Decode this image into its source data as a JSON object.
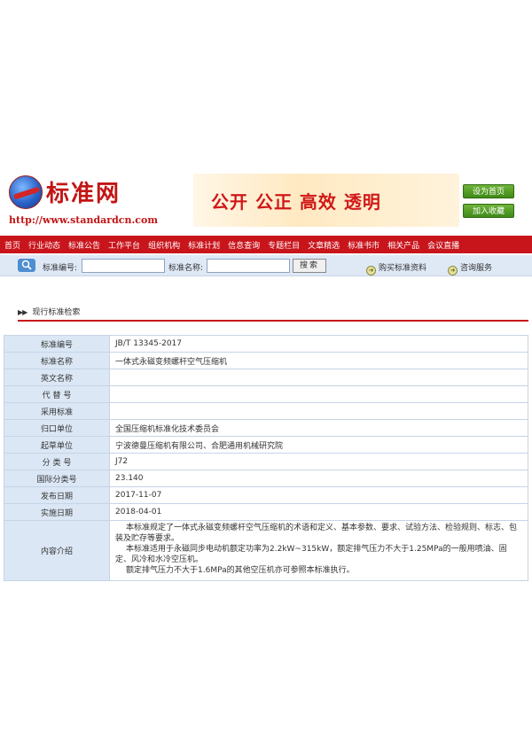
{
  "header": {
    "logo_text": "标准网",
    "logo_url": "http://www.standardcn.com",
    "slogan": "公开 公正 高效 透明",
    "set_home_label": "设为首页",
    "add_fav_label": "加入收藏"
  },
  "nav": {
    "items": [
      "首页",
      "行业动态",
      "标准公告",
      "工作平台",
      "组织机构",
      "标准计划",
      "信息查询",
      "专题栏目",
      "文章精选",
      "标准书市",
      "相关产品",
      "会议直播"
    ]
  },
  "search": {
    "std_no_label": "标准编号:",
    "std_name_label": "标准名称:",
    "search_button": "搜索",
    "buy_link": "购买标准资料",
    "consult_link": "咨询服务"
  },
  "breadcrumb": {
    "title": "现行标准检索"
  },
  "record": {
    "rows": [
      {
        "label": "标准编号",
        "value": "JB/T 13345-2017"
      },
      {
        "label": "标准名称",
        "value": "一体式永磁变频螺杆空气压缩机"
      },
      {
        "label": "英文名称",
        "value": ""
      },
      {
        "label": "代 替 号",
        "value": ""
      },
      {
        "label": "采用标准",
        "value": ""
      },
      {
        "label": "归口单位",
        "value": "全国压缩机标准化技术委员会"
      },
      {
        "label": "起草单位",
        "value": "宁波德曼压缩机有限公司、合肥通用机械研究院"
      },
      {
        "label": "分 类 号",
        "value": "J72"
      },
      {
        "label": "国际分类号",
        "value": "23.140"
      },
      {
        "label": "发布日期",
        "value": "2017-11-07"
      },
      {
        "label": "实施日期",
        "value": "2018-04-01"
      }
    ],
    "intro_label": "内容介绍",
    "intro_paragraphs": [
      "本标准规定了一体式永磁变频螺杆空气压缩机的术语和定义、基本参数、要求、试验方法、检验规则、标志、包装及贮存等要求。",
      "本标准适用于永磁同步电动机额定功率为2.2kW~315kW，额定排气压力不大于1.25MPa的一般用喷油、固定、风冷和水冷空压机。",
      "额定排气压力不大于1.6MPa的其他空压机亦可参照本标准执行。"
    ]
  }
}
